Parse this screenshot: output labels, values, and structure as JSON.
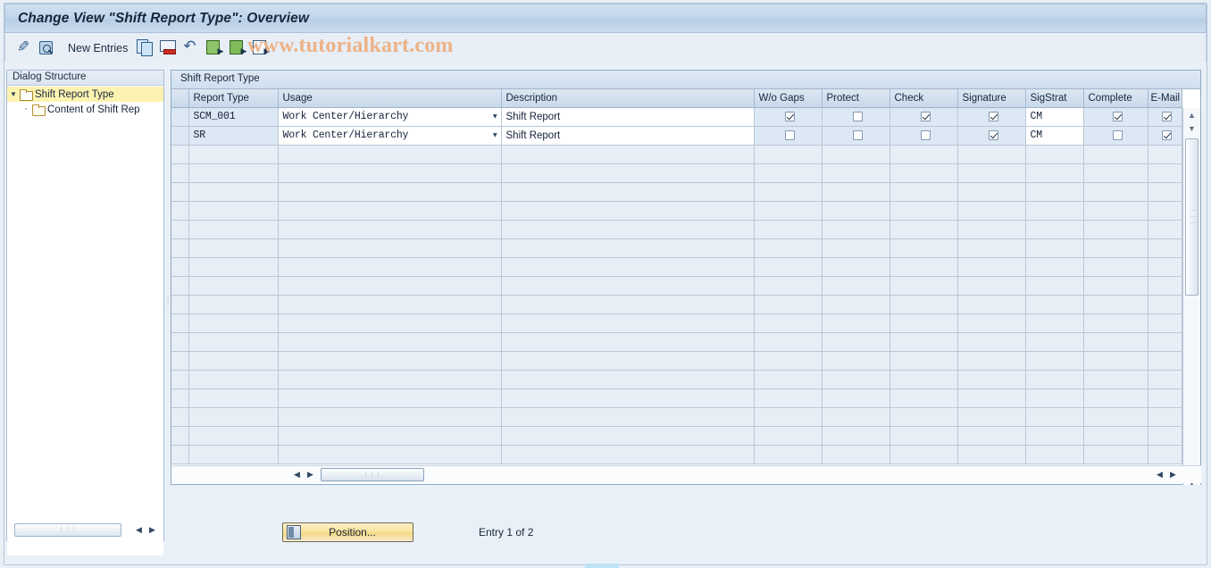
{
  "window": {
    "title": "Change View \"Shift Report Type\": Overview",
    "watermark": "www.tutorialkart.com"
  },
  "toolbar": {
    "new_entries_label": "New Entries",
    "icons": [
      {
        "name": "display-change-icon",
        "title": "Display/Change"
      },
      {
        "name": "check-magnifier-icon",
        "title": "Check"
      },
      {
        "name": "copy-as-icon",
        "title": "Copy As..."
      },
      {
        "name": "delete-icon",
        "title": "Delete"
      },
      {
        "name": "undo-icon",
        "title": "Undo Change"
      },
      {
        "name": "select-all-icon",
        "title": "Select All"
      },
      {
        "name": "select-block-icon",
        "title": "Select Block"
      },
      {
        "name": "deselect-all-icon",
        "title": "Deselect All"
      }
    ]
  },
  "sidebar": {
    "header": "Dialog Structure",
    "tree": [
      {
        "label": "Shift Report Type",
        "selected": true,
        "level": 0,
        "expanded": true
      },
      {
        "label": "Content of Shift Rep",
        "selected": false,
        "level": 1,
        "expanded": false
      }
    ]
  },
  "grid": {
    "caption": "Shift Report Type",
    "columns": [
      "Report Type",
      "Usage",
      "Description",
      "W/o Gaps",
      "Protect",
      "Check",
      "Signature",
      "SigStrat",
      "Complete",
      "E-Mail"
    ],
    "rows": [
      {
        "report_type": "SCM_001",
        "usage": "Work Center/Hierarchy",
        "description": "Shift Report",
        "wo_gaps": true,
        "protect": false,
        "check": true,
        "signature": true,
        "sigstrat": "CM",
        "complete": true,
        "email": true
      },
      {
        "report_type": "SR",
        "usage": "Work Center/Hierarchy",
        "description": "Shift Report",
        "wo_gaps": false,
        "protect": false,
        "check": false,
        "signature": true,
        "sigstrat": "CM",
        "complete": false,
        "email": true
      }
    ],
    "empty_row_count": 17
  },
  "footer": {
    "position_button": "Position...",
    "entry_status": "Entry 1 of 2"
  },
  "colors": {
    "title_bar": "#c3d6ea",
    "selection_yellow": "#fdf3b0",
    "data_row": "#dce8f4",
    "empty_row": "#e8eef6",
    "watermark": "#edb286",
    "button_yellow": "#f7e29a"
  }
}
